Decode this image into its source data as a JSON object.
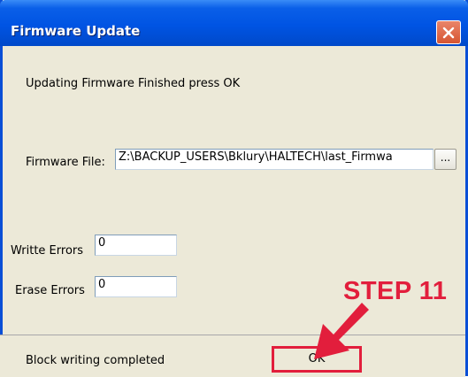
{
  "window": {
    "title": "Firmware Update"
  },
  "message": "Updating Firmware Finished press OK",
  "firmware": {
    "label": "Firmware File:",
    "path": "Z:\\BACKUP_USERS\\Bklury\\HALTECH\\last_Firmwa",
    "browse_label": "..."
  },
  "errors": {
    "write_label": "Writte Errors",
    "write_value": "0",
    "erase_label": "Erase Errors",
    "erase_value": "0"
  },
  "status": {
    "text": "Block writing completed",
    "ok_label": "OK"
  },
  "annotation": {
    "step_label": "STEP 11"
  },
  "colors": {
    "titlebar": "#0054e3",
    "close_button": "#d65532",
    "annotation": "#e21e3c",
    "dialog_bg": "#ece9d8"
  },
  "icons": {
    "close": "close-icon",
    "annotation_arrow": "arrow-icon"
  }
}
